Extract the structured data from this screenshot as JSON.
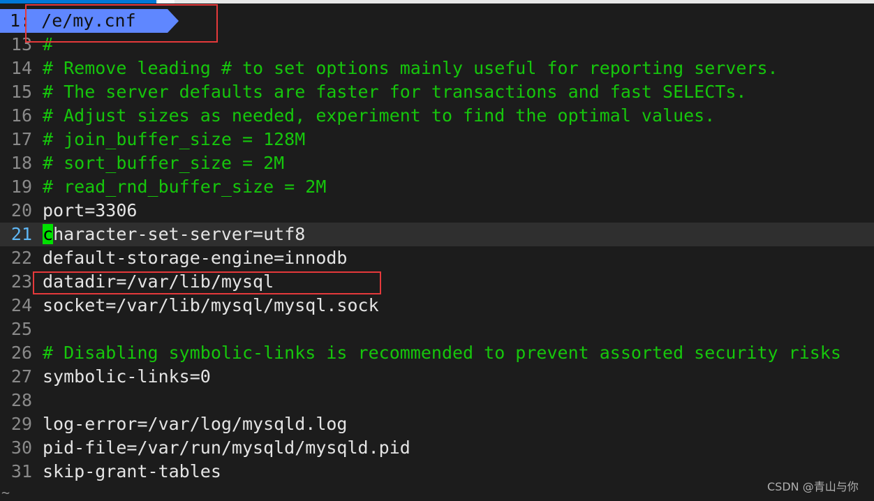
{
  "header": {
    "title": "1: /e/my.cnf"
  },
  "lines": [
    {
      "n": "13",
      "t": "#",
      "comment": true
    },
    {
      "n": "14",
      "t": "# Remove leading # to set options mainly useful for reporting servers.",
      "comment": true
    },
    {
      "n": "15",
      "t": "# The server defaults are faster for transactions and fast SELECTs.",
      "comment": true
    },
    {
      "n": "16",
      "t": "# Adjust sizes as needed, experiment to find the optimal values.",
      "comment": true
    },
    {
      "n": "17",
      "t": "# join_buffer_size = 128M",
      "comment": true
    },
    {
      "n": "18",
      "t": "# sort_buffer_size = 2M",
      "comment": true
    },
    {
      "n": "19",
      "t": "# read_rnd_buffer_size = 2M",
      "comment": true
    },
    {
      "n": "20",
      "t": "port=3306"
    },
    {
      "n": "21",
      "t": "character-set-server=utf8",
      "current": true
    },
    {
      "n": "22",
      "t": "default-storage-engine=innodb"
    },
    {
      "n": "23",
      "t": "datadir=/var/lib/mysql"
    },
    {
      "n": "24",
      "t": "socket=/var/lib/mysql/mysql.sock"
    },
    {
      "n": "25",
      "t": ""
    },
    {
      "n": "26",
      "t": "# Disabling symbolic-links is recommended to prevent assorted security risks",
      "comment": true
    },
    {
      "n": "27",
      "t": "symbolic-links=0"
    },
    {
      "n": "28",
      "t": ""
    },
    {
      "n": "29",
      "t": "log-error=/var/log/mysqld.log"
    },
    {
      "n": "30",
      "t": "pid-file=/var/run/mysqld/mysqld.pid"
    },
    {
      "n": "31",
      "t": "skip-grant-tables"
    }
  ],
  "end_marker": "~",
  "watermark": "CSDN @青山与你",
  "colors": {
    "comment": "#16c60c",
    "header": "#5f87ff",
    "highlight_box": "#e5393b",
    "cursor": "#00e000"
  }
}
